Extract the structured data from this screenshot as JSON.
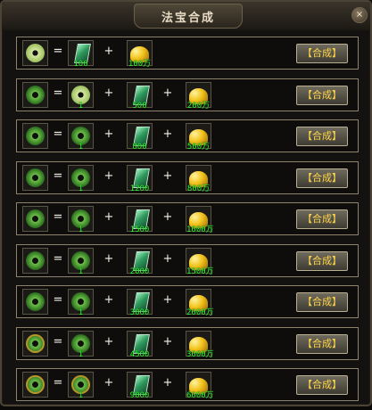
{
  "title": "法宝合成",
  "close_icon": "×",
  "button_label": "【合成】",
  "colors": {
    "quantity_text": "#33ff33",
    "button_text": "#ffd64a",
    "row_border": "#8d826c"
  },
  "rows": [
    {
      "result": "jade-disc-tier1",
      "ingredient": null,
      "stone_qty": "100",
      "gold_qty": "100万"
    },
    {
      "result": "jade-disc-tier2",
      "ingredient": {
        "item": "jade-disc-tier1",
        "qty": "1"
      },
      "stone_qty": "500",
      "gold_qty": "200万"
    },
    {
      "result": "jade-disc-tier3",
      "ingredient": {
        "item": "jade-disc-tier2",
        "qty": "1"
      },
      "stone_qty": "800",
      "gold_qty": "500万"
    },
    {
      "result": "jade-disc-tier4",
      "ingredient": {
        "item": "jade-disc-tier3",
        "qty": "1"
      },
      "stone_qty": "1200",
      "gold_qty": "800万"
    },
    {
      "result": "jade-disc-tier5",
      "ingredient": {
        "item": "jade-disc-tier4",
        "qty": "1"
      },
      "stone_qty": "1500",
      "gold_qty": "1000万"
    },
    {
      "result": "jade-dragon-tier6",
      "ingredient": {
        "item": "jade-disc-tier5",
        "qty": "1"
      },
      "stone_qty": "2000",
      "gold_qty": "1500万"
    },
    {
      "result": "jade-dragon-tier7",
      "ingredient": {
        "item": "jade-dragon-tier6",
        "qty": "1"
      },
      "stone_qty": "3000",
      "gold_qty": "2000万"
    },
    {
      "result": "gold-jade-tier8",
      "ingredient": {
        "item": "jade-dragon-tier7",
        "qty": "1"
      },
      "stone_qty": "4500",
      "gold_qty": "3000万"
    },
    {
      "result": "gold-jade-tier9",
      "ingredient": {
        "item": "gold-jade-tier8",
        "qty": "1"
      },
      "stone_qty": "9000",
      "gold_qty": "6000万"
    }
  ]
}
